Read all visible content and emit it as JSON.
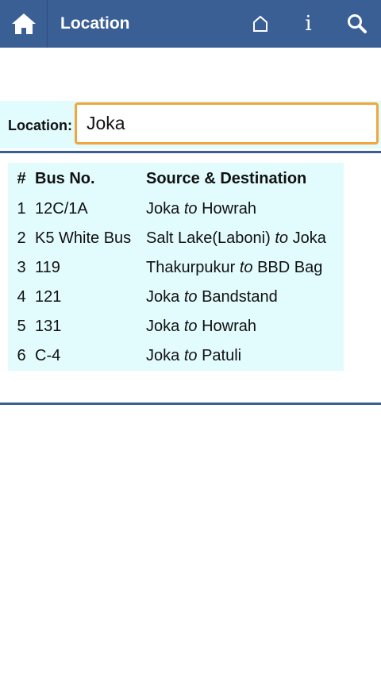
{
  "header": {
    "title": "Location",
    "home_icon": "home-icon",
    "actions": [
      "home-outline-icon",
      "info-icon",
      "search-icon"
    ]
  },
  "search": {
    "label": "Location:",
    "value": "Joka",
    "accent_color": "#f0a63c"
  },
  "results": {
    "columns": [
      "#",
      "Bus No.",
      "Source & Destination"
    ],
    "connector": "to",
    "rows": [
      {
        "num": "1",
        "bus": "12C/1A",
        "source": "Joka",
        "destination": "Howrah"
      },
      {
        "num": "2",
        "bus": "K5 White Bus",
        "source": "Salt Lake(Laboni)",
        "destination": "Joka"
      },
      {
        "num": "3",
        "bus": "119",
        "source": "Thakurpukur",
        "destination": "BBD Bag"
      },
      {
        "num": "4",
        "bus": "121",
        "source": "Joka",
        "destination": "Bandstand"
      },
      {
        "num": "5",
        "bus": "131",
        "source": "Joka",
        "destination": "Howrah"
      },
      {
        "num": "6",
        "bus": "C-4",
        "source": "Joka",
        "destination": "Patuli"
      }
    ]
  },
  "colors": {
    "header_bg": "#3a5f95",
    "panel_bg": "#e2fbfd"
  }
}
